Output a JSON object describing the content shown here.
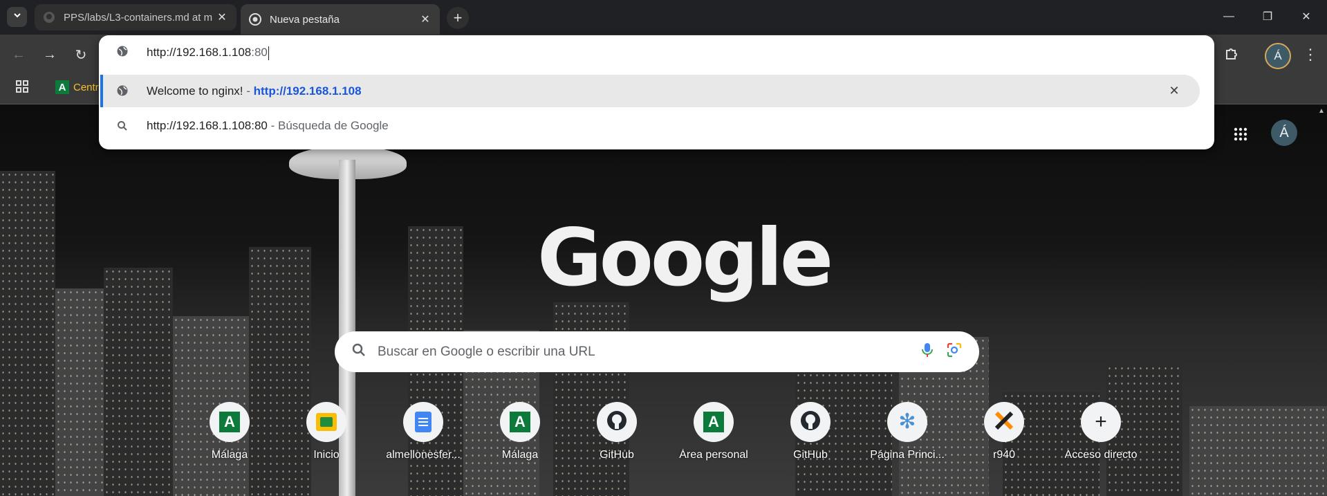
{
  "tabs": [
    {
      "title": "PPS/labs/L3-containers.md at m",
      "favicon": "github-icon",
      "active": false
    },
    {
      "title": "Nueva pestaña",
      "favicon": "chrome-icon",
      "active": true
    }
  ],
  "omnibox": {
    "typed_base": "http://192.168.1.108",
    "typed_suffix": ":80",
    "suggestions": [
      {
        "icon": "globe-icon",
        "title": "Welcome to nginx!",
        "separator": " - ",
        "url": "http://192.168.1.108",
        "selected": true
      },
      {
        "icon": "search-icon",
        "title": "http://192.168.1.108:80",
        "separator": " - ",
        "detail": "Búsqueda de Google",
        "selected": false
      }
    ]
  },
  "bookmarks": {
    "items": [
      {
        "label": "Centr",
        "icon": "andalucia-icon"
      }
    ]
  },
  "profile": {
    "initial": "Á"
  },
  "ntp": {
    "logo": "Google",
    "search_placeholder": "Buscar en Google o escribir una URL",
    "avatar_initial": "Á",
    "shortcuts": [
      {
        "label": "Málaga",
        "icon": "andalucia-icon"
      },
      {
        "label": "Inicio",
        "icon": "classroom-icon"
      },
      {
        "label": "almellonesfer...",
        "icon": "docs-icon"
      },
      {
        "label": "Málaga",
        "icon": "andalucia-icon"
      },
      {
        "label": "GitHub",
        "icon": "github-icon"
      },
      {
        "label": "Área personal",
        "icon": "andalucia-icon"
      },
      {
        "label": "GitHub",
        "icon": "github-icon"
      },
      {
        "label": "Página Princi...",
        "icon": "snowflake-icon"
      },
      {
        "label": "r940",
        "icon": "x-logo-icon"
      },
      {
        "label": "Acceso directo",
        "icon": "plus-icon"
      }
    ]
  },
  "colors": {
    "accent": "#1a73e8",
    "url_link": "#1a56d6",
    "andalucia_green": "#0b7a3b"
  }
}
